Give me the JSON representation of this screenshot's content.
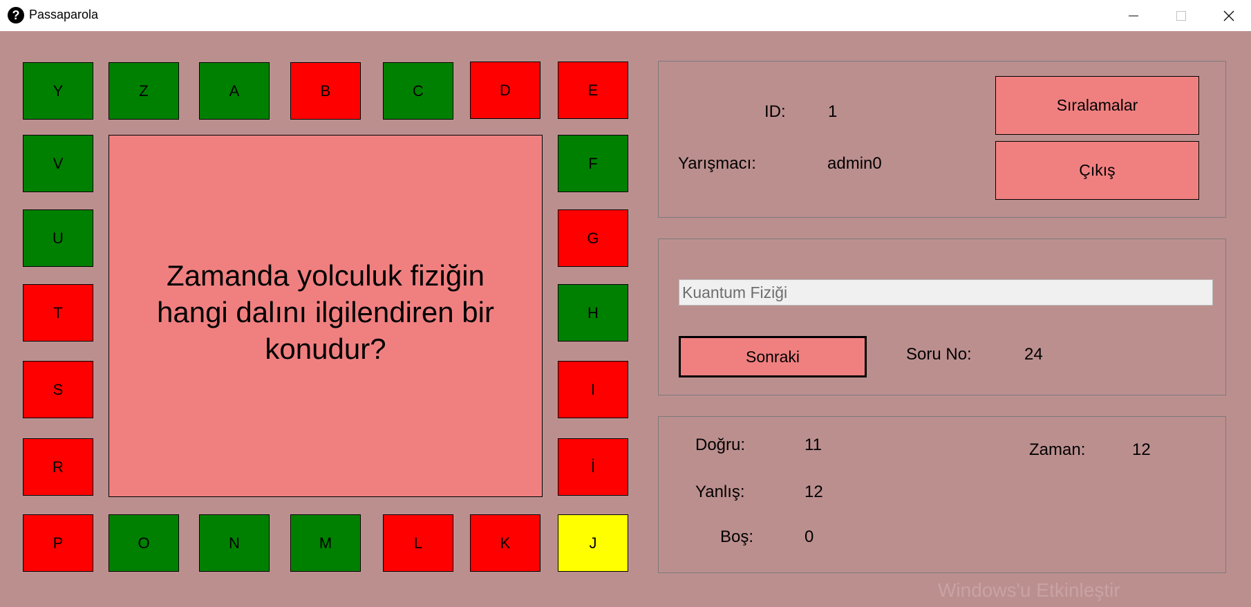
{
  "window": {
    "title": "Passaparola",
    "help_icon": "?"
  },
  "letters": [
    {
      "letter": "Y",
      "color": "#008000"
    },
    {
      "letter": "Z",
      "color": "#008000"
    },
    {
      "letter": "A",
      "color": "#008000"
    },
    {
      "letter": "B",
      "color": "#ff0000"
    },
    {
      "letter": "C",
      "color": "#008000"
    },
    {
      "letter": "D",
      "color": "#ff0000"
    },
    {
      "letter": "E",
      "color": "#ff0000"
    },
    {
      "letter": "F",
      "color": "#008000"
    },
    {
      "letter": "G",
      "color": "#ff0000"
    },
    {
      "letter": "H",
      "color": "#008000"
    },
    {
      "letter": "I",
      "color": "#ff0000"
    },
    {
      "letter": "İ",
      "color": "#ff0000"
    },
    {
      "letter": "J",
      "color": "#ffff00"
    },
    {
      "letter": "K",
      "color": "#ff0000"
    },
    {
      "letter": "L",
      "color": "#ff0000"
    },
    {
      "letter": "M",
      "color": "#008000"
    },
    {
      "letter": "N",
      "color": "#008000"
    },
    {
      "letter": "O",
      "color": "#008000"
    },
    {
      "letter": "P",
      "color": "#ff0000"
    },
    {
      "letter": "R",
      "color": "#ff0000"
    },
    {
      "letter": "S",
      "color": "#ff0000"
    },
    {
      "letter": "T",
      "color": "#ff0000"
    },
    {
      "letter": "U",
      "color": "#008000"
    },
    {
      "letter": "V",
      "color": "#008000"
    }
  ],
  "question": {
    "text": "Zamanda yolculuk fiziğin hangi dalını ilgilendiren bir konudur?"
  },
  "user": {
    "id_label": "ID:",
    "id_value": "1",
    "contestant_label": "Yarışmacı:",
    "contestant_value": "admin0",
    "rankings_button": "Sıralamalar",
    "exit_button": "Çıkış"
  },
  "answer": {
    "value": "Kuantum Fiziği",
    "next_button": "Sonraki",
    "question_no_label": "Soru No:",
    "question_no_value": "24"
  },
  "stats": {
    "correct_label": "Doğru:",
    "correct_value": "11",
    "wrong_label": "Yanlış:",
    "wrong_value": "12",
    "empty_label": "Boş:",
    "empty_value": "0",
    "time_label": "Zaman:",
    "time_value": "12"
  },
  "watermark": "Windows'u Etkinleştir",
  "colors": {
    "background": "#bc8f8f",
    "panel": "#f08080",
    "correct": "#008000",
    "wrong": "#ff0000",
    "current": "#ffff00"
  }
}
